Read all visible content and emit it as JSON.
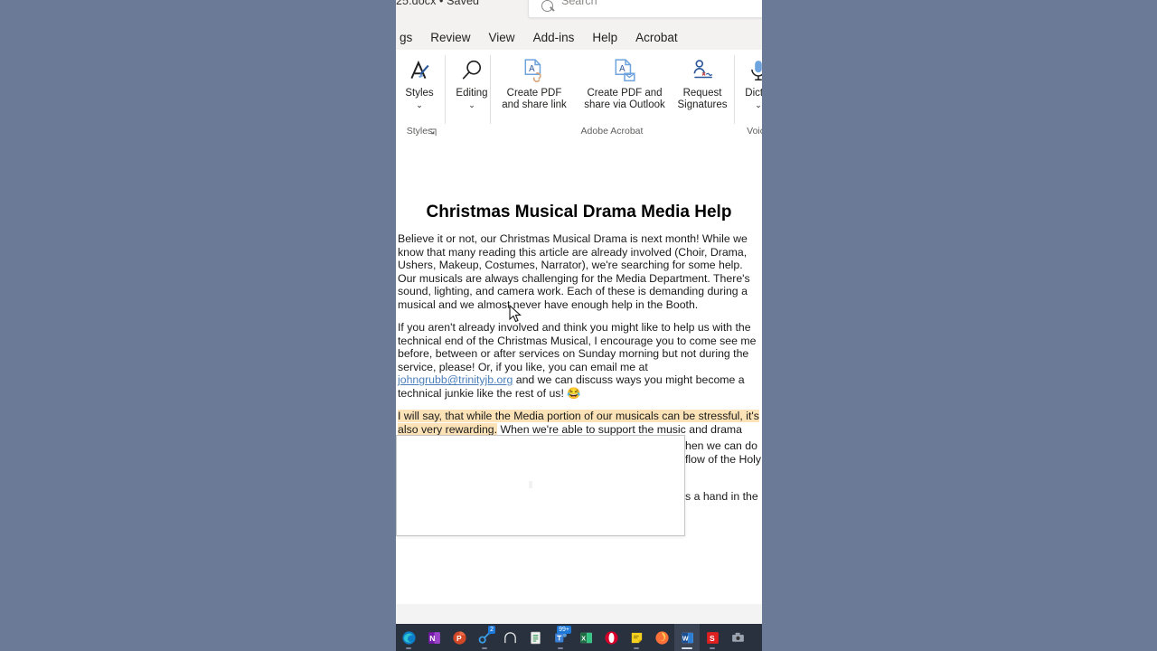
{
  "app": {
    "title_fragment": "25.docx • Saved",
    "title_caret": "▾"
  },
  "search": {
    "placeholder": "Search",
    "icon": "search-icon"
  },
  "ribbon_tabs": [
    {
      "label": "gs",
      "name": "tab-mailings-clipped"
    },
    {
      "label": "Review",
      "name": "tab-review"
    },
    {
      "label": "View",
      "name": "tab-view"
    },
    {
      "label": "Add-ins",
      "name": "tab-add-ins"
    },
    {
      "label": "Help",
      "name": "tab-help"
    },
    {
      "label": "Acrobat",
      "name": "tab-acrobat"
    }
  ],
  "ribbon": {
    "groups": [
      {
        "name": "styles",
        "label": "Styles",
        "has_dialog_launcher": true,
        "launcher_glyph": "⌐"
      },
      {
        "name": "adobe-acrobat",
        "label": "Adobe Acrobat",
        "has_dialog_launcher": false
      },
      {
        "name": "voice",
        "label": "Voice",
        "has_dialog_launcher": false
      }
    ],
    "buttons": {
      "styles": {
        "label": "Styles",
        "icon": "styles-pen-icon",
        "caret": "⌄"
      },
      "editing": {
        "label": "Editing",
        "icon": "magnifier-icon",
        "caret": "⌄"
      },
      "create_pdf": {
        "line1": "Create PDF",
        "line2": "and share link",
        "icon": "pdf-link-icon"
      },
      "create_pdf_outlook": {
        "line1": "Create PDF and",
        "line2": "share via Outlook",
        "icon": "pdf-mail-icon"
      },
      "request_signatures": {
        "line1": "Request",
        "line2": "Signatures",
        "icon": "signature-icon"
      },
      "dictate": {
        "label": "Dictat",
        "icon": "microphone-icon",
        "caret": "⌄"
      }
    }
  },
  "document": {
    "heading": "Christmas Musical Drama Media Help",
    "paragraph_1": "Believe it or not, our Christmas Musical Drama is next month!  While we know that many reading this article are already involved (Choir, Drama, Ushers, Makeup, Costumes, Narrator), we're searching for some help. Our musicals are always challenging for the Media Department.  There's sound, lighting, and camera work.  Each of these is demanding during a musical and we almost never have enough help in the Booth.",
    "paragraph_2_before_link": "If you aren't already involved and think you might like to help us with the technical end of the Christmas Musical, I encourage you to come see me before, between or after services on Sunday morning but not during the service, please!  Or, if you like, you can email me at ",
    "paragraph_2_link": "johngrubb@trinityjb.org",
    "paragraph_2_after_link": " and we can discuss ways you might become a technical junkie like the rest of us!  😂",
    "paragraph_3_highlighted": "I will say, that while the Media portion of our musicals can be stressful, it's also very rewarding.",
    "paragraph_3_rest": "  When we're able to support the music and drama",
    "occluded_fragment_1": "hen we can do",
    "occluded_fragment_2": "flow of the Holy",
    "occluded_fragment_3": "s a hand in the"
  },
  "overlay": {
    "name": "blank-popup-panel",
    "content": ""
  },
  "taskbar": {
    "items": [
      {
        "name": "taskbar-edge",
        "icon": "edge-icon",
        "label": "Microsoft Edge",
        "active": false,
        "badge": ""
      },
      {
        "name": "taskbar-onenote",
        "icon": "onenote-icon",
        "label": "OneNote",
        "active": false,
        "badge": ""
      },
      {
        "name": "taskbar-powerpoint",
        "icon": "powerpoint-icon",
        "label": "PowerPoint",
        "active": false,
        "badge": ""
      },
      {
        "name": "taskbar-keeper",
        "icon": "key-icon",
        "label": "Password Manager",
        "active": false,
        "badge": "2"
      },
      {
        "name": "taskbar-arch",
        "icon": "arch-icon",
        "label": "Arch",
        "active": false,
        "badge": ""
      },
      {
        "name": "taskbar-notepad",
        "icon": "notepad-icon",
        "label": "Notepad",
        "active": false,
        "badge": ""
      },
      {
        "name": "taskbar-teams",
        "icon": "teams-icon",
        "label": "Teams",
        "active": false,
        "badge": "99+"
      },
      {
        "name": "taskbar-excel",
        "icon": "excel-icon",
        "label": "Excel",
        "active": false,
        "badge": ""
      },
      {
        "name": "taskbar-opera",
        "icon": "opera-icon",
        "label": "Opera",
        "active": false,
        "badge": ""
      },
      {
        "name": "taskbar-stickynotes",
        "icon": "sticky-note-icon",
        "label": "Sticky Notes",
        "active": false,
        "badge": ""
      },
      {
        "name": "taskbar-firefox",
        "icon": "firefox-icon",
        "label": "Firefox",
        "active": false,
        "badge": ""
      },
      {
        "name": "taskbar-word",
        "icon": "word-icon",
        "label": "Word",
        "active": true,
        "badge": ""
      },
      {
        "name": "taskbar-snagit",
        "icon": "snagit-icon",
        "label": "Snagit",
        "active": false,
        "badge": ""
      },
      {
        "name": "taskbar-camera",
        "icon": "camera-icon",
        "label": "Camera",
        "active": false,
        "badge": ""
      }
    ]
  },
  "colors": {
    "desktop": "#6b7a96",
    "ribbon_accent": "#2b579a",
    "highlight": "#fbe2b7",
    "link": "#4a7ebb",
    "taskbar": "#29313f"
  }
}
